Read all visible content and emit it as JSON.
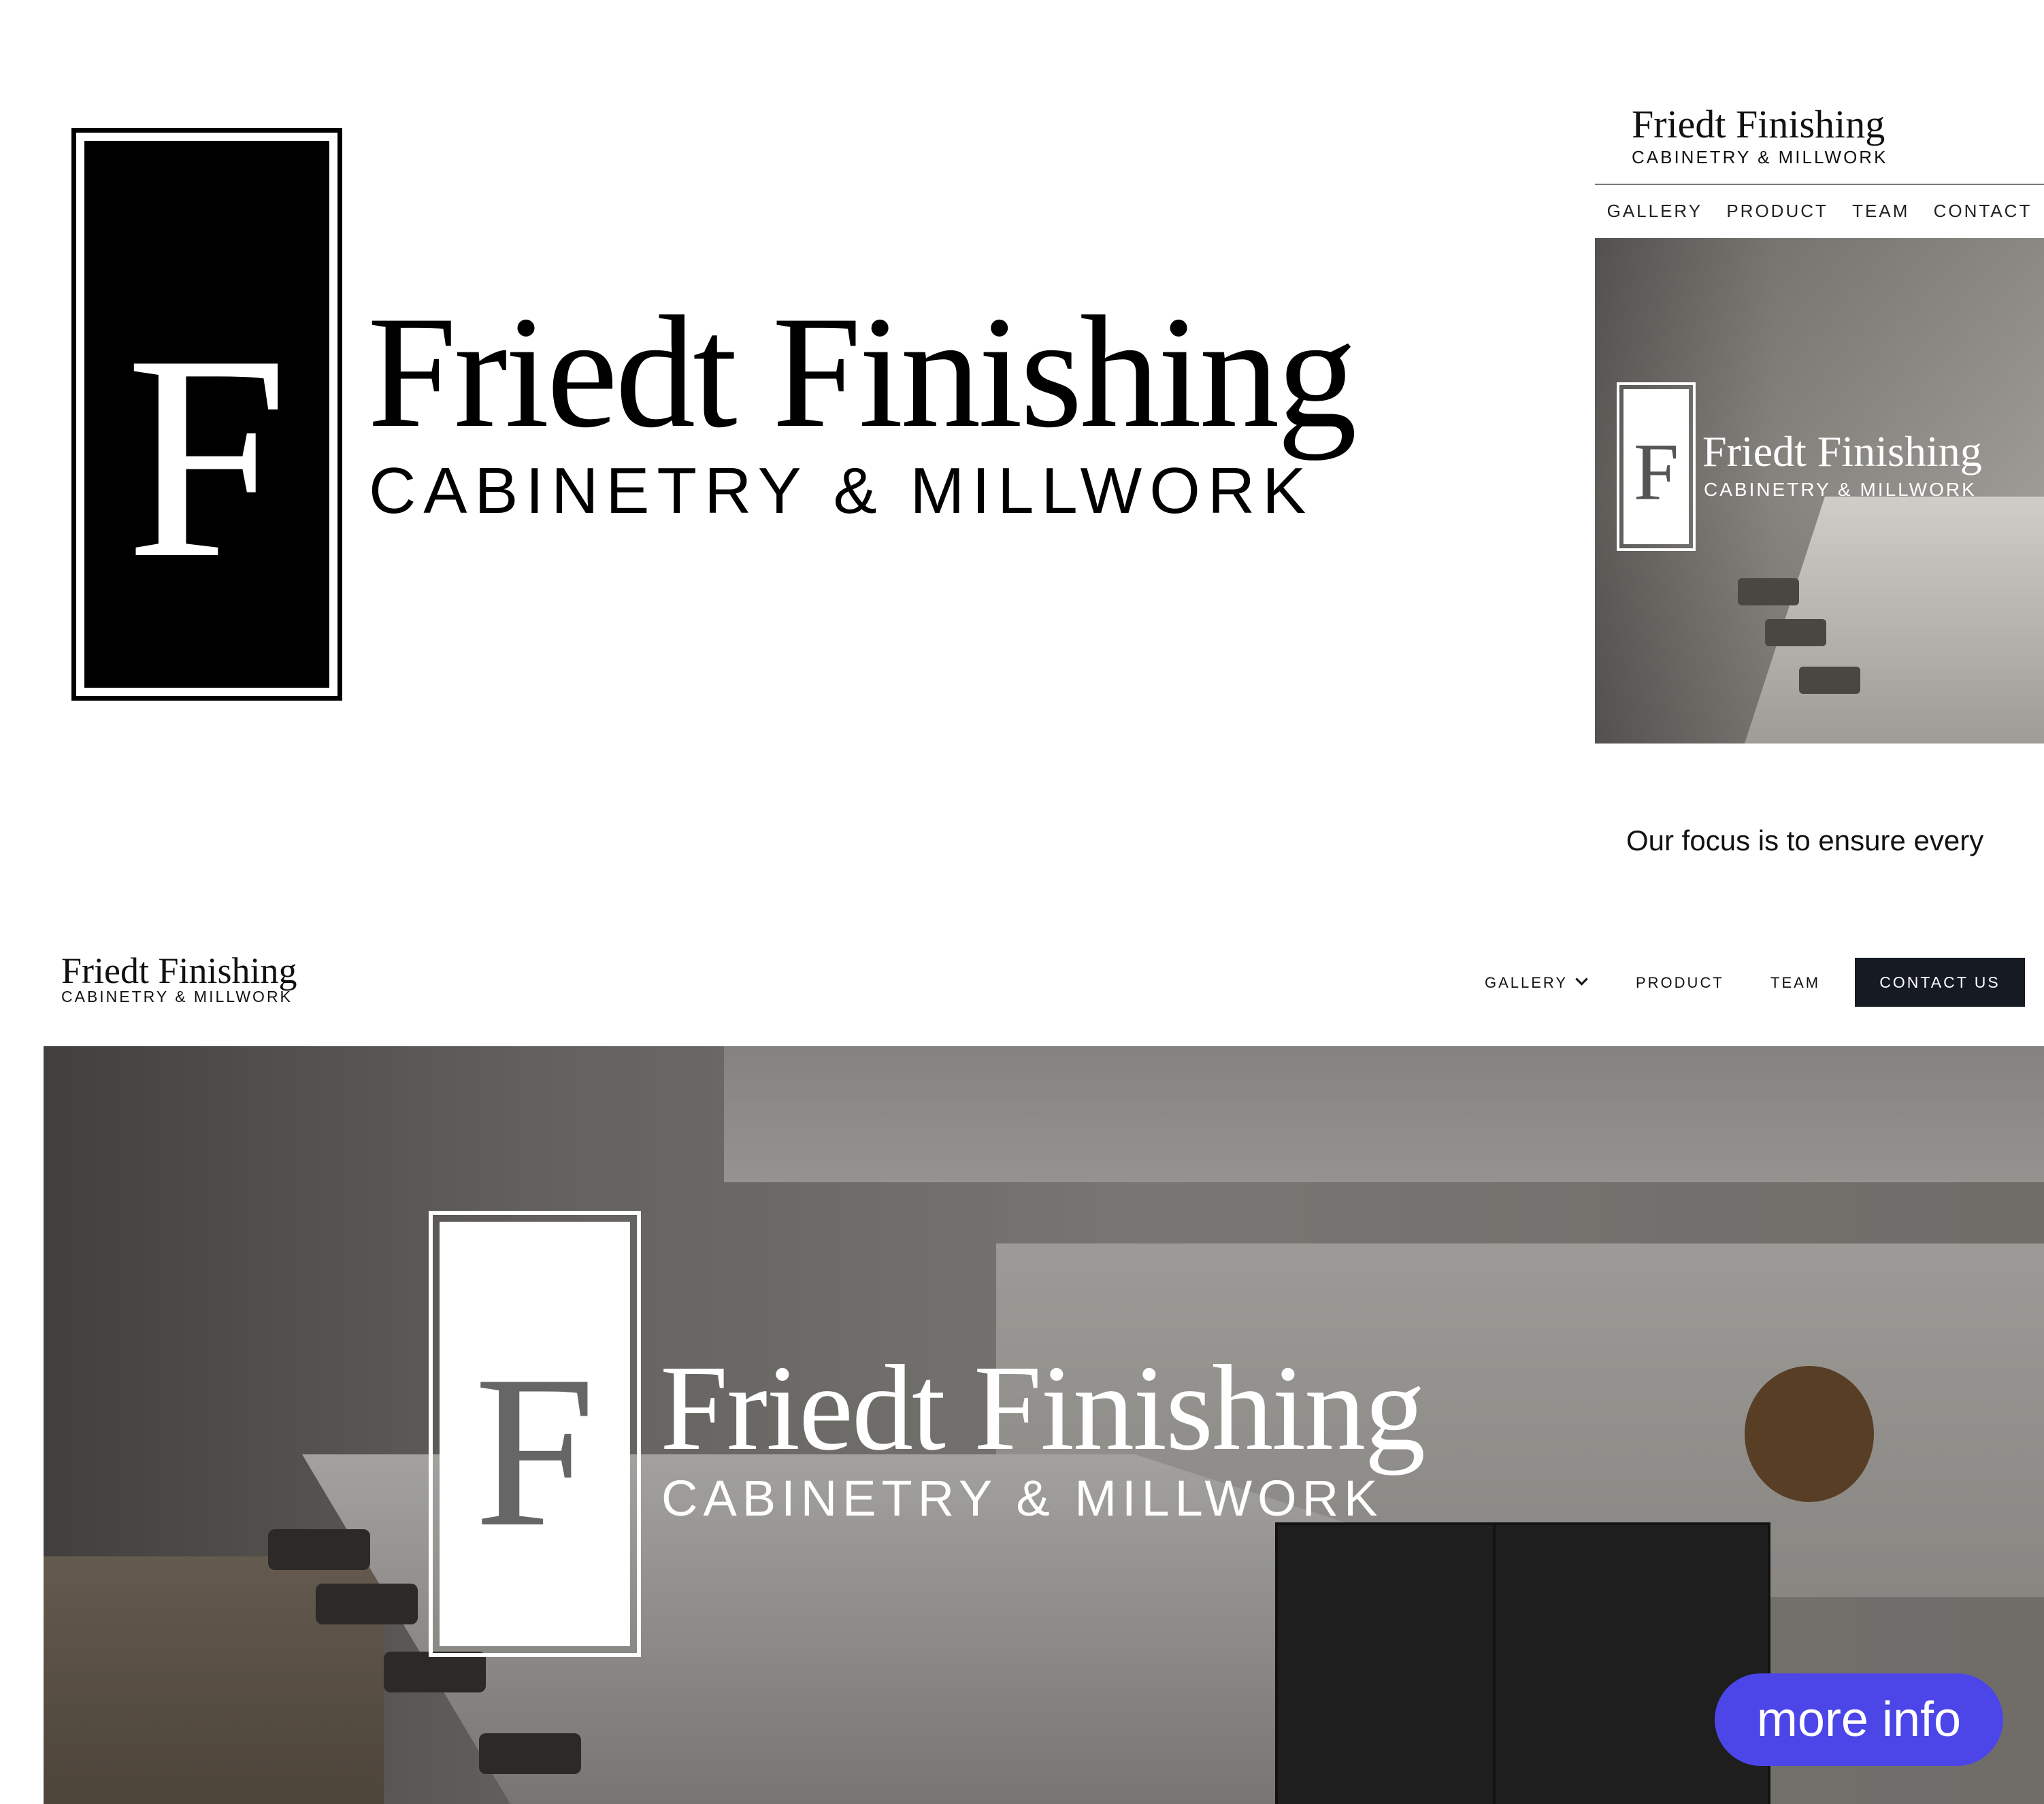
{
  "brand": {
    "name": "Friedt Finishing",
    "tagline": "CABINETRY & MILLWORK",
    "monogram": "F"
  },
  "mobile": {
    "nav": [
      "GALLERY",
      "PRODUCT",
      "TEAM",
      "CONTACT"
    ],
    "focus_text": "Our focus is to ensure every"
  },
  "desktop": {
    "nav": {
      "gallery": "GALLERY",
      "product": "PRODUCT",
      "team": "TEAM",
      "contact": "CONTACT US"
    }
  },
  "more_info_label": "more info",
  "colors": {
    "logo_black": "#000000",
    "contact_button": "#161a22",
    "more_info_button": "#4c46e8"
  },
  "icons": [
    "chevron-down-icon"
  ]
}
